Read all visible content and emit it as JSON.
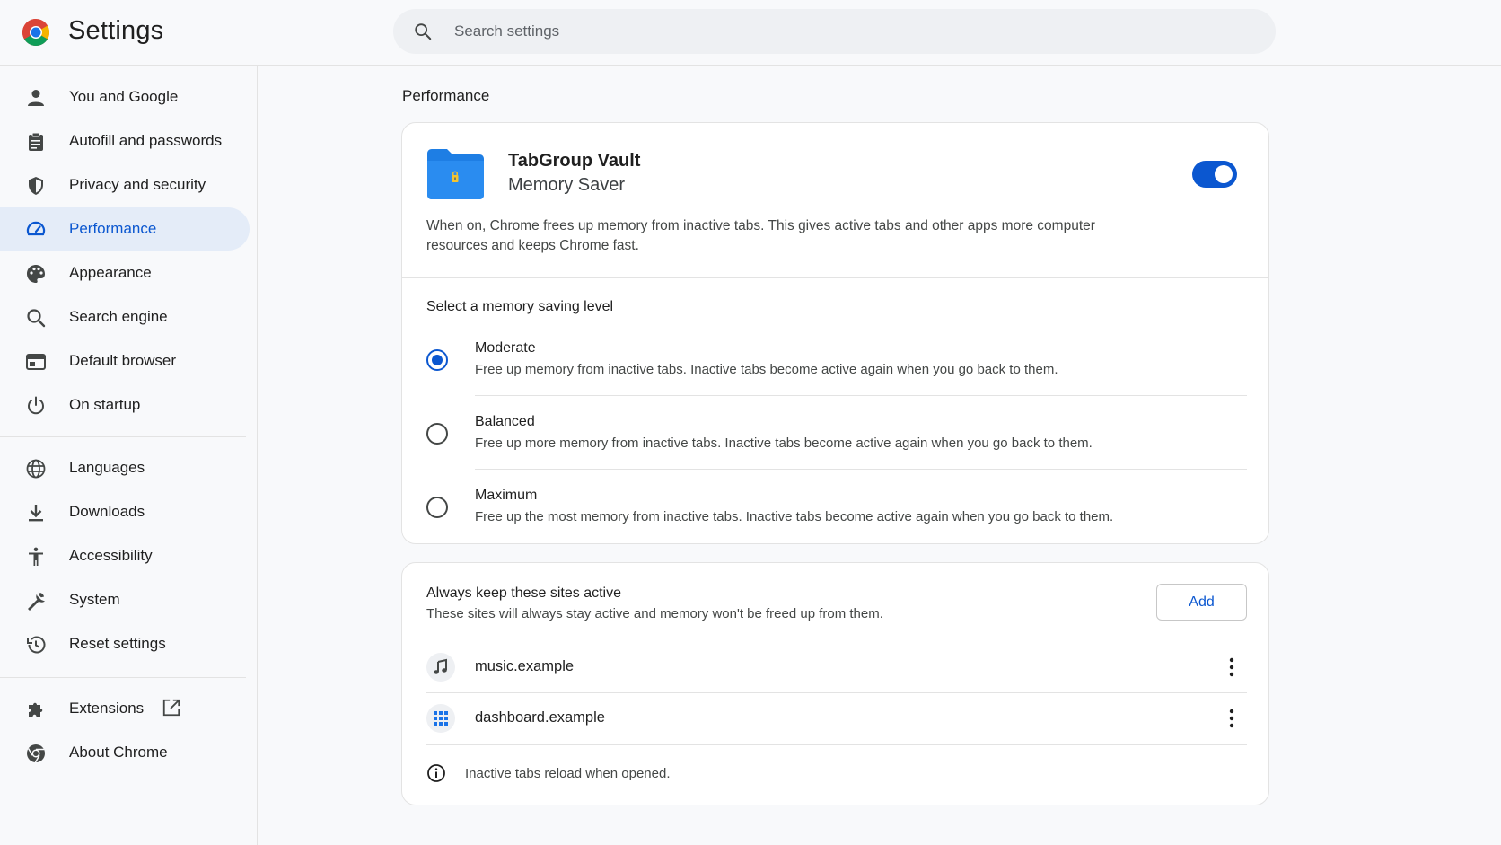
{
  "app": {
    "title": "Settings"
  },
  "search": {
    "placeholder": "Search settings"
  },
  "sidebar": {
    "items": [
      {
        "label": "You and Google",
        "icon": "person-icon"
      },
      {
        "label": "Autofill and passwords",
        "icon": "clipboard-icon"
      },
      {
        "label": "Privacy and security",
        "icon": "shield-icon"
      },
      {
        "label": "Performance",
        "icon": "gauge-icon",
        "active": true
      },
      {
        "label": "Appearance",
        "icon": "palette-icon"
      },
      {
        "label": "Search engine",
        "icon": "search-icon"
      },
      {
        "label": "Default browser",
        "icon": "browser-window-icon"
      },
      {
        "label": "On startup",
        "icon": "power-icon"
      },
      {
        "label": "Languages",
        "icon": "globe-icon"
      },
      {
        "label": "Downloads",
        "icon": "download-icon"
      },
      {
        "label": "Accessibility",
        "icon": "accessibility-icon"
      },
      {
        "label": "System",
        "icon": "wrench-icon"
      },
      {
        "label": "Reset settings",
        "icon": "history-icon"
      },
      {
        "label": "Extensions",
        "icon": "puzzle-icon"
      },
      {
        "label": "About Chrome",
        "icon": "chrome-icon"
      }
    ]
  },
  "main": {
    "section_title": "Performance",
    "memory_card": {
      "name": "TabGroup Vault",
      "subtitle": "Memory Saver",
      "toggle_on": true,
      "description": "When on, Chrome frees up memory from inactive tabs. This gives active tabs and other apps more computer resources and keeps Chrome fast.",
      "level_title": "Select a memory saving level",
      "levels": [
        {
          "label": "Moderate",
          "desc": "Free up memory from inactive tabs. Inactive tabs become active again when you go back to them.",
          "selected": true
        },
        {
          "label": "Balanced",
          "desc": "Free up more memory from inactive tabs. Inactive tabs become active again when you go back to them.",
          "selected": false
        },
        {
          "label": "Maximum",
          "desc": "Free up the most memory from inactive tabs. Inactive tabs become active again when you go back to them.",
          "selected": false
        }
      ]
    },
    "sites_card": {
      "title": "Always keep these sites active",
      "description": "These sites will always stay active and memory won't be freed up from them.",
      "add_label": "Add",
      "sites": [
        {
          "name": "music.example",
          "icon": "music-note-icon"
        },
        {
          "name": "dashboard.example",
          "icon": "grid-icon"
        }
      ],
      "info": "Inactive tabs reload when opened."
    }
  },
  "colors": {
    "accent": "#0b57d0",
    "active_nav_bg": "#e4ecf8",
    "page_bg": "#f8f9fb"
  }
}
